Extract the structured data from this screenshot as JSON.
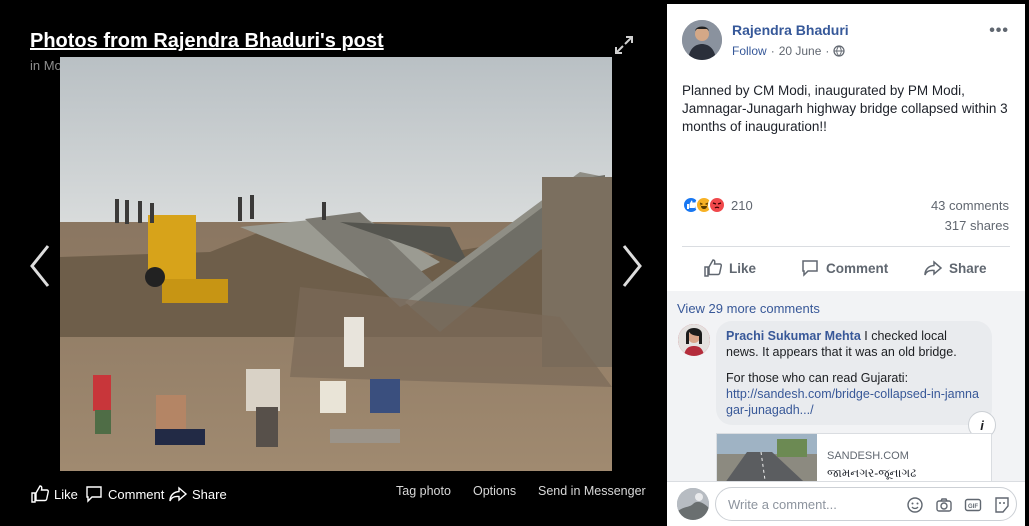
{
  "theater": {
    "title": "Photos from Rajendra Bhaduri's post",
    "subtitle": "in Mobile Uploads",
    "actions": {
      "like": "Like",
      "comment": "Comment",
      "share": "Share",
      "tag_photo": "Tag photo",
      "options": "Options",
      "send_messenger": "Send in Messenger"
    }
  },
  "post": {
    "author": "Rajendra Bhaduri",
    "follow": "Follow",
    "separator": "·",
    "date": "20 June",
    "more": "•••",
    "text": "Planned by CM Modi, inaugurated by PM Modi, Jamnagar-Junagarh highway bridge collapsed within 3 months of inauguration!!",
    "reaction_count": "210",
    "comments_count": "43 comments",
    "shares_count": "317 shares",
    "actions": {
      "like": "Like",
      "comment": "Comment",
      "share": "Share"
    }
  },
  "comments": {
    "view_more": "View 29 more comments",
    "items": [
      {
        "name": "Prachi Sukumar Mehta",
        "text": "I checked local news. It appears that it was an old bridge.",
        "text2": "For those who can read Gujarati:",
        "link": "http://sandesh.com/bridge-collapsed-in-jamnagar-junagadh.../",
        "preview": {
          "domain": "SANDESH.COM",
          "title": "જામનગર-જૂનાગઢ"
        }
      }
    ]
  },
  "composer": {
    "placeholder": "Write a comment..."
  },
  "colors": {
    "link": "#365899",
    "text": "#1d2129",
    "muted": "#616770",
    "like_blue": "#1877f2",
    "angry": "#f0484b",
    "haha": "#f7b125"
  },
  "icons": [
    "expand-icon",
    "chevron-left-icon",
    "chevron-right-icon",
    "thumbs-up-icon",
    "comment-icon",
    "share-icon",
    "globe-icon",
    "emoji-icon",
    "camera-icon",
    "gif-icon",
    "sticker-icon"
  ]
}
